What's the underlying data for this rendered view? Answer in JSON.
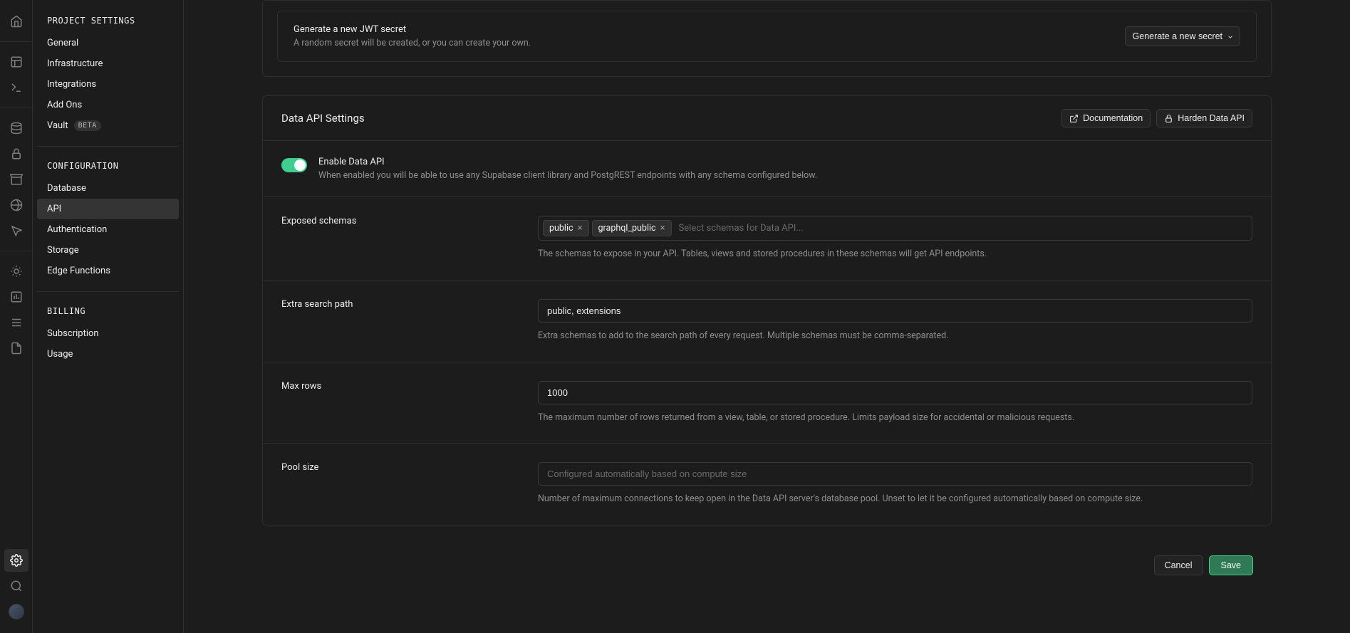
{
  "iconRail": {
    "top": [
      {
        "name": "home-icon"
      },
      {
        "name": "table-editor-icon"
      },
      {
        "name": "sql-editor-icon"
      },
      {
        "name": "database-icon"
      },
      {
        "name": "auth-icon"
      },
      {
        "name": "storage-icon"
      },
      {
        "name": "edge-functions-icon"
      },
      {
        "name": "realtime-icon"
      },
      {
        "name": "advisors-icon"
      },
      {
        "name": "reports-icon"
      },
      {
        "name": "logs-icon"
      },
      {
        "name": "api-docs-icon"
      }
    ],
    "bottom": [
      {
        "name": "settings-icon",
        "active": true
      },
      {
        "name": "search-icon"
      },
      {
        "name": "user-avatar"
      }
    ]
  },
  "sidebar": {
    "group1": {
      "heading": "PROJECT SETTINGS",
      "items": [
        {
          "label": "General"
        },
        {
          "label": "Infrastructure"
        },
        {
          "label": "Integrations"
        },
        {
          "label": "Add Ons"
        },
        {
          "label": "Vault",
          "badge": "BETA"
        }
      ]
    },
    "group2": {
      "heading": "CONFIGURATION",
      "items": [
        {
          "label": "Database"
        },
        {
          "label": "API",
          "active": true
        },
        {
          "label": "Authentication"
        },
        {
          "label": "Storage"
        },
        {
          "label": "Edge Functions"
        }
      ]
    },
    "group3": {
      "heading": "BILLING",
      "items": [
        {
          "label": "Subscription"
        },
        {
          "label": "Usage"
        }
      ]
    }
  },
  "jwtCard": {
    "title": "Generate a new JWT secret",
    "desc": "A random secret will be created, or you can create your own.",
    "buttonLabel": "Generate a new secret"
  },
  "dataApi": {
    "sectionTitle": "Data API Settings",
    "docButton": "Documentation",
    "hardenButton": "Harden Data API",
    "enable": {
      "title": "Enable Data API",
      "desc": "When enabled you will be able to use any Supabase client library and PostgREST endpoints with any schema configured below.",
      "on": true
    },
    "exposedSchemas": {
      "label": "Exposed schemas",
      "tags": [
        "public",
        "graphql_public"
      ],
      "placeholder": "Select schemas for Data API...",
      "helper": "The schemas to expose in your API. Tables, views and stored procedures in these schemas will get API endpoints."
    },
    "extraSearchPath": {
      "label": "Extra search path",
      "value": "public, extensions",
      "helper": "Extra schemas to add to the search path of every request. Multiple schemas must be comma-separated."
    },
    "maxRows": {
      "label": "Max rows",
      "value": "1000",
      "helper": "The maximum number of rows returned from a view, table, or stored procedure. Limits payload size for accidental or malicious requests."
    },
    "poolSize": {
      "label": "Pool size",
      "value": "",
      "placeholder": "Configured automatically based on compute size",
      "helper": "Number of maximum connections to keep open in the Data API server's database pool. Unset to let it be configured automatically based on compute size."
    },
    "footer": {
      "cancel": "Cancel",
      "save": "Save"
    }
  }
}
